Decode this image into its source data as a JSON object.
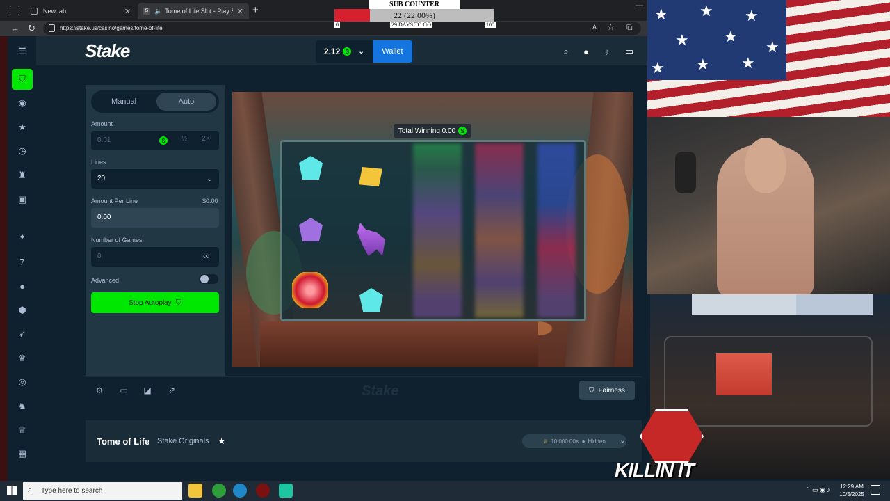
{
  "browser": {
    "tabs": [
      {
        "label": "New tab",
        "active": false
      },
      {
        "label": "Tome of Life Slot - Play Stak",
        "active": true
      }
    ],
    "url": "https://stake.us/casino/games/tome-of-life"
  },
  "sub_counter": {
    "title": "SUB COUNTER",
    "value_text": "22 (22.00%)",
    "progress_percent": 22,
    "min_label": "0",
    "days_label": "29 DAYS TO GO",
    "max_label": "100"
  },
  "header": {
    "logo": "Stake",
    "balance": "2.12",
    "coin_symbol": "S",
    "wallet_label": "Wallet"
  },
  "bet_panel": {
    "mode_manual": "Manual",
    "mode_auto": "Auto",
    "amount_label": "Amount",
    "amount_placeholder": "0.01",
    "half_label": "½",
    "double_label": "2×",
    "lines_label": "Lines",
    "lines_value": "20",
    "amount_per_line_label": "Amount Per Line",
    "amount_per_line_right": "$0.00",
    "amount_per_line_value": "0.00",
    "number_of_games_label": "Number of Games",
    "number_of_games_value": "0",
    "infinity_symbol": "∞",
    "advanced_label": "Advanced",
    "stop_button": "Stop Autoplay"
  },
  "game": {
    "total_winning_label": "Total Winning 0.00",
    "watermark": "Stake",
    "fairness_label": "Fairness"
  },
  "info_bar": {
    "title": "Tome of Life",
    "provider": "Stake Originals",
    "max_win": "10,000.00×",
    "hidden_label": "Hidden"
  },
  "overlay": {
    "brand_text": "KILLIN IT"
  },
  "taskbar": {
    "search_placeholder": "Type here to search",
    "time": "12:29 AM",
    "date": "10/5/2025"
  },
  "colors": {
    "accent_green": "#00e701",
    "wallet_blue": "#1475e1",
    "panel": "#213743",
    "bg": "#0f212e"
  }
}
